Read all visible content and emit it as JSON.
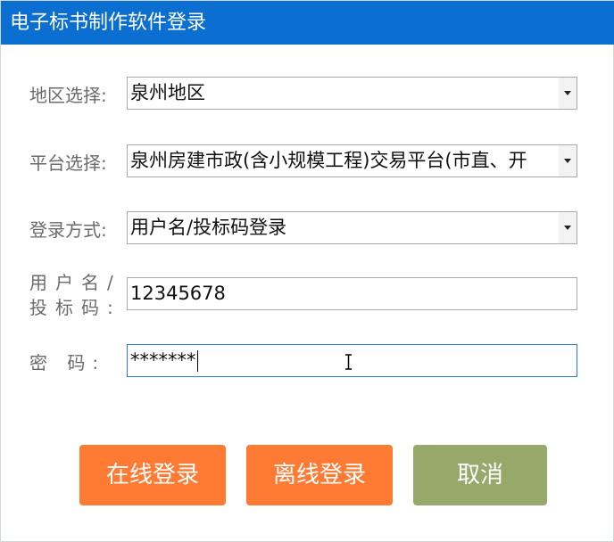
{
  "window": {
    "title": "电子标书制作软件登录"
  },
  "form": {
    "region": {
      "label": "地区选择:",
      "value": "泉州地区"
    },
    "platform": {
      "label": "平台选择:",
      "value": "泉州房建市政(含小规模工程)交易平台(市直、开"
    },
    "login_method": {
      "label": "登录方式:",
      "value": "用户名/投标码登录"
    },
    "username": {
      "label_line1": "用户名/",
      "label_line2": "投标码:",
      "value": "12345678"
    },
    "password": {
      "label": "密  码:",
      "value": "*******"
    }
  },
  "buttons": {
    "online_login": "在线登录",
    "offline_login": "离线登录",
    "cancel": "取消"
  },
  "colors": {
    "title_bar": "#0b6fd1",
    "primary_button": "#ff7a33",
    "cancel_button": "#97a86b",
    "label_text": "#6b6b6b",
    "focus_border": "#2b7cd3"
  },
  "icons": {
    "dropdown": "chevron-down-icon",
    "cursor": "text-cursor-icon"
  }
}
